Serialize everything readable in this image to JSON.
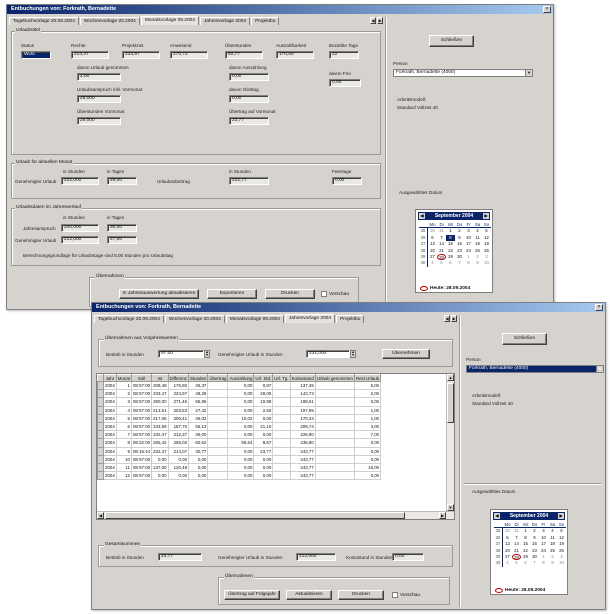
{
  "window1": {
    "title": "Entbuchungen von: Forkrath, Bernadette",
    "tabs": [
      "Tagebuchvorlage 20.08.2004",
      "Wochenvorlage 20.2004",
      "Monatsvorlage 09.2004",
      "Jahresvorlage 2004",
      "Projektbu"
    ],
    "active_tab": 2,
    "soll_ist": {
      "group_title": "Urlaubstitel",
      "headers": [
        "Status",
        "Rechte",
        "Projektzeit",
        "Anwesend",
        "Überstunden",
        "Auszahlbarkeit",
        "Bezahlte Tage"
      ],
      "values": [
        "WiJo",
        "214,47",
        "233,97",
        "270,72",
        "50,77",
        "170,00",
        "22"
      ],
      "left_labels": [
        "davon Urlaub genommen",
        "Urlaubsanspruch inkl. Vormonat",
        "Überstunden Vormonat"
      ],
      "left_values": [
        "2,00",
        "28,000",
        "26,000"
      ],
      "right_labels": [
        "davon Auszahlung",
        "davon Gleittag",
        "Übertrag auf Vormonat"
      ],
      "right_values": [
        "0,00",
        "0,00",
        "23,77"
      ],
      "extra_label": "davon Frei",
      "extra_value": "0,00"
    },
    "monat": {
      "group_title": "Urlaub für aktuellen Monat",
      "h_stunden": "in Stunden",
      "h_tage": "in Tagen",
      "h_stunden2": "in Stunden",
      "h_feiertage": "Feiertage",
      "row_label": "Genehmigter Urlaub",
      "v1": "232,000",
      "v2": "29,00",
      "mid_label": "Urlaubsübertrag",
      "v3": "232,77",
      "v4": "0,00"
    },
    "jahr": {
      "group_title": "Urlaubsdaten im Jahresverlauf",
      "h_stunden": "in Stunden",
      "h_tage": "in Tagen",
      "rows": [
        {
          "label": "Jahresanspruch",
          "v1": "240,000",
          "v2": "30,00"
        },
        {
          "label": "Genehmigter Urlaub",
          "v1": "212,000",
          "v2": "27,00"
        }
      ],
      "note": "Berechnungsgrundlage für Urlaubstage sind 8,00 Stunden pro Urlaubstag"
    },
    "options_label": "Übernahmen",
    "buttons": [
      "In Jahresauswertung aktualisieren",
      "Exportieren",
      "Drucken"
    ],
    "check_label": "Vorschau"
  },
  "window2": {
    "title": "Entbuchungen von: Forkrath, Bernadette",
    "tabs": [
      "Tagebuchvorlage 20.08.2004",
      "Wochenvorlage 20.2004",
      "Monatsvorlage 09.2004",
      "Jahresvorlage 2004",
      "Projektbu"
    ],
    "active_tab": 3,
    "top_group_title": "Übernahmen aus Vorjahreswerten",
    "top_label1": "Betrieb in Stunden",
    "top_value1": "97,00",
    "top_label2": "Genehmigter Urlaub in Stunden",
    "top_value2": "231,000",
    "top_button": "Übernehmen",
    "table_headers": [
      "Jahr",
      "Monat",
      "Soll",
      "Ist",
      "Differenz",
      "Stunden",
      "Übertrag",
      "Auszahlung",
      "Url. Std.",
      "Url. Tg.",
      "Kontostand",
      "Urlaub genommen",
      "Rest Urlaub"
    ],
    "table_rows": [
      [
        "2004",
        "1",
        "08:57:00",
        "208,48",
        "176,80",
        "26,37",
        "",
        "0,00",
        "0,87",
        "",
        "137,45",
        "",
        "5,00"
      ],
      [
        "2004",
        "2",
        "08:57:00",
        "233,47",
        "224,97",
        "48,28",
        "",
        "0,00",
        "28,05",
        "",
        "143,73",
        "",
        "2,00"
      ],
      [
        "2004",
        "3",
        "08:57:00",
        "290,00",
        "271,46",
        "65,96",
        "",
        "0,00",
        "10,98",
        "",
        "198,61",
        "",
        "0,00"
      ],
      [
        "2004",
        "4",
        "08:57:00",
        "213,51",
        "203,53",
        "27,42",
        "",
        "0,00",
        "2,50",
        "",
        "197,95",
        "",
        "1,00"
      ],
      [
        "2004",
        "5",
        "08:57:00",
        "217,05",
        "200,41",
        "46,02",
        "",
        "10,02",
        "0,00",
        "",
        "170,34",
        "",
        "1,00"
      ],
      [
        "2004",
        "6",
        "08:57:00",
        "233,59",
        "187,70",
        "55,13",
        "",
        "0,00",
        "21,10",
        "",
        "209,74",
        "",
        "3,00"
      ],
      [
        "2004",
        "7",
        "08:57:00",
        "232,47",
        "212,37",
        "36,00",
        "",
        "0,00",
        "0,00",
        "",
        "226,90",
        "",
        "7,00"
      ],
      [
        "2004",
        "8",
        "08:22:00",
        "265,42",
        "265,02",
        "60,62",
        "",
        "56,64",
        "8,67",
        "",
        "235,90",
        "",
        "0,00"
      ],
      [
        "2004",
        "9",
        "08:15:44",
        "232,47",
        "214,07",
        "30,77",
        "",
        "0,00",
        "23,77",
        "",
        "243,77",
        "",
        "0,00"
      ],
      [
        "2004",
        "10",
        "08:57:00",
        "0,00",
        "0,00",
        "0,00",
        "",
        "0,00",
        "0,00",
        "",
        "243,77",
        "",
        "0,00"
      ],
      [
        "2004",
        "11",
        "08:57:00",
        "137,00",
        "120,48",
        "0,00",
        "",
        "0,00",
        "0,00",
        "",
        "243,77",
        "",
        "16,00"
      ],
      [
        "2004",
        "12",
        "08:57:00",
        "0,00",
        "0,00",
        "0,00",
        "",
        "0,00",
        "0,00",
        "",
        "243,77",
        "",
        "0,00"
      ]
    ],
    "bottom_group_title": "Gesamtsummen",
    "bottom_label1": "Betrieb in Stunden",
    "bottom_value1": "23,77",
    "bottom_label2": "Genehmigter Urlaub in Stunden",
    "bottom_value2": "212,000",
    "bottom_label3": "Kontostand in Stunden",
    "bottom_value3": "0,00",
    "options_label": "Übernahmen",
    "buttons": [
      "Übertrag auf Folgejahr",
      "Aktualisieren",
      "Drucken"
    ],
    "check_label": "Vorschau"
  },
  "side_panel": {
    "close_button": "Schließen",
    "person_label": "Person",
    "person_value": "Forkrath, Bernadette (4000)",
    "info_title": "Arbeitsmodell:",
    "info_value": "Standard Vollzeit 40",
    "date_label": "Ausgewähltes Datum",
    "calendar": {
      "month": "September 2004",
      "day_headers": [
        "",
        "Mo",
        "Di",
        "Mi",
        "Do",
        "Fr",
        "Sa",
        "So"
      ],
      "weeks": [
        [
          "35",
          "30",
          "31",
          "1",
          "2",
          "3",
          "4",
          "5"
        ],
        [
          "36",
          "6",
          "7",
          "8",
          "9",
          "10",
          "11",
          "12"
        ],
        [
          "37",
          "13",
          "14",
          "15",
          "16",
          "17",
          "18",
          "19"
        ],
        [
          "38",
          "20",
          "21",
          "22",
          "23",
          "24",
          "25",
          "26"
        ],
        [
          "39",
          "27",
          "28",
          "29",
          "30",
          "1",
          "2",
          "3"
        ],
        [
          "40",
          "4",
          "5",
          "6",
          "7",
          "8",
          "9",
          "10"
        ]
      ],
      "today_label": "Heute: 28.09.2004"
    }
  }
}
